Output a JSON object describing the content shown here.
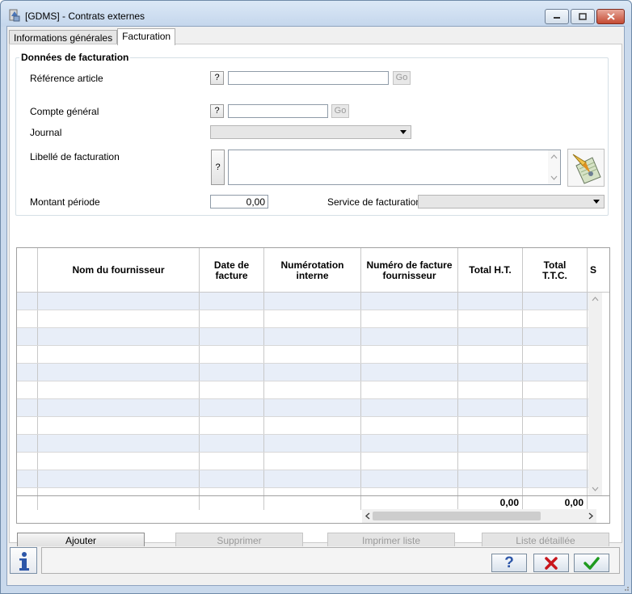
{
  "window": {
    "title": "[GDMS] - Contrats externes"
  },
  "tabs": [
    {
      "label": "Informations générales"
    },
    {
      "label": "Facturation"
    }
  ],
  "billing": {
    "group_title": "Données de facturation",
    "reference_article": {
      "label": "Référence article",
      "help": "?",
      "value": "",
      "go": "Go"
    },
    "compte_general": {
      "label": "Compte général",
      "help": "?",
      "value": "",
      "go": "Go"
    },
    "journal": {
      "label": "Journal",
      "value": ""
    },
    "libelle": {
      "label": "Libellé de facturation",
      "help": "?",
      "value": ""
    },
    "montant": {
      "label": "Montant période",
      "value": "0,00"
    },
    "service": {
      "label": "Service de facturation",
      "value": ""
    }
  },
  "grid": {
    "columns": [
      {
        "label": ""
      },
      {
        "label": "Nom du fournisseur"
      },
      {
        "label": "Date de\nfacture"
      },
      {
        "label": "Numérotation\ninterne"
      },
      {
        "label": "Numéro de facture\nfournisseur"
      },
      {
        "label": "Total H.T."
      },
      {
        "label": "Total\nT.T.C."
      },
      {
        "label": "S"
      }
    ],
    "totals": {
      "ht": "0,00",
      "ttc": "0,00"
    }
  },
  "actions": {
    "ajouter": "Ajouter",
    "supprimer": "Supprimer",
    "imprimer": "Imprimer liste",
    "liste_detaillee": "Liste détaillée"
  },
  "footer": {
    "help": "?",
    "status": ""
  },
  "colors": {
    "row_alt": "#e8eef8",
    "cancel_red": "#c8151b",
    "ok_green": "#1f9a1f",
    "help_blue": "#2c56a8"
  }
}
